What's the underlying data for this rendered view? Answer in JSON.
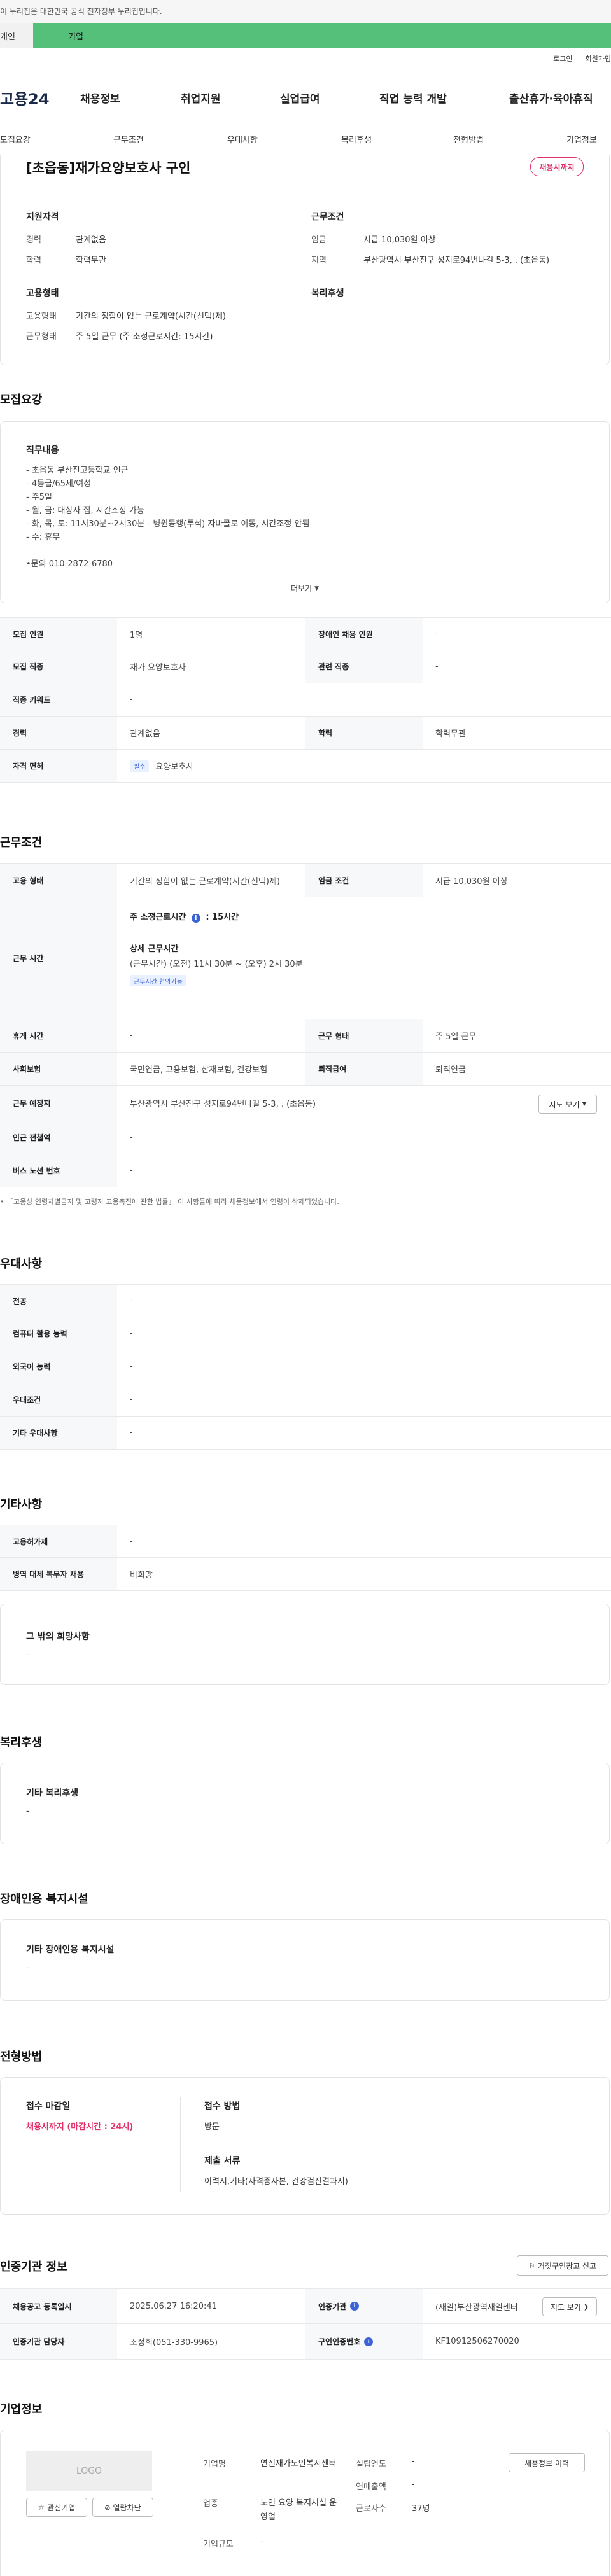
{
  "gov_notice": "이 누리집은 대한민국 공식 전자정부 누리집입니다.",
  "top_tabs": [
    "개인",
    "기업"
  ],
  "util_links": [
    "로그인",
    "회원가입"
  ],
  "logo": "고용24",
  "gnb": [
    "채용정보",
    "취업지원",
    "실업급여",
    "직업 능력 개발",
    "출산휴가·육아휴직"
  ],
  "subnav": [
    "모집요강",
    "근무조건",
    "우대사항",
    "복리후생",
    "전형방법",
    "기업정보"
  ],
  "job": {
    "title": "[초읍동]재가요양보호사 구인",
    "status_badge": "채용시까지",
    "summary": {
      "qual_title": "지원자격",
      "career_label": "경력",
      "career_value": "관계없음",
      "edu_label": "학력",
      "edu_value": "학력무관",
      "emp_title": "고용형태",
      "emp_type_label": "고용형태",
      "emp_type_value": "기간의 정함이 없는 근로계약(시간(선택)제)",
      "work_form_label": "근무형태",
      "work_form_value": "주 5일 근무 (주 소정근로시간: 15시간)",
      "cond_title": "근무조건",
      "wage_label": "임금",
      "wage_value": "시급 10,030원 이상",
      "region_label": "지역",
      "region_value": "부산광역시 부산진구 성지로94번나길 5-3, . (초읍동)",
      "welfare_title": "복리후생"
    }
  },
  "recruit": {
    "title": "모집요강",
    "duty_title": "직무내용",
    "duty_lines": [
      "- 초읍동 부산진고등학교 인근",
      "- 4등급/65세/여성",
      "- 주5일",
      "- 월, 금: 대상자 집, 시간조정 가능",
      "- 화, 목, 토: 11시30분~2시30분 - 병원동행(투석) 자바콜로 이동, 시간조정 안됨",
      "- 수: 휴무",
      "",
      "•문의 010-2872-6780"
    ],
    "more_label": "더보기",
    "rows": [
      {
        "k": "모집 인원",
        "v": "1명",
        "k2": "장애인 채용 인원",
        "v2": "-"
      },
      {
        "k": "모집 직종",
        "v": "재가 요양보호사",
        "k2": "관련 직종",
        "v2": "-"
      },
      {
        "k": "직종 키워드",
        "v": "-"
      },
      {
        "k": "경력",
        "v": "관계없음",
        "k2": "학력",
        "v2": "학력무관"
      }
    ],
    "license_label": "자격 면허",
    "license_chip": "필수",
    "license_value": "요양보호사"
  },
  "work": {
    "title": "근무조건",
    "emp_type_label": "고용 형태",
    "emp_type_value": "기간의 정함이 없는 근로계약(시간(선택)제)",
    "wage_label": "임금 조건",
    "wage_value": "시급 10,030원 이상",
    "hours_label": "근무 시간",
    "weekly_hours_label": "주 소정근로시간",
    "weekly_hours_value": "15시간",
    "detail_hours_label": "상세 근무시간",
    "detail_hours_value": "(근무시간) (오전) 11시 30분 ~ (오후) 2시 30분",
    "hours_chip": "근무시간 협의가능",
    "rows": [
      {
        "k": "휴게 시간",
        "v": "-",
        "k2": "근무 형태",
        "v2": "주 5일 근무"
      },
      {
        "k": "사회보험",
        "v": "국민연금, 고용보험, 산재보험, 건강보험",
        "k2": "퇴직급여",
        "v2": "퇴직연금"
      }
    ],
    "location_label": "근무 예정지",
    "location_value": "부산광역시 부산진구 성지로94번나길 5-3, . (초읍동)",
    "map_button": "지도 보기",
    "subway_label": "인근 전철역",
    "subway_value": "-",
    "bus_label": "버스 노선 번호",
    "bus_value": "-",
    "notice": "「고용상 연령차별금지 및 고령자 고용촉진에 관한 법률」 이 사항들에 따라 채용정보에서 연령이 삭제되었습니다."
  },
  "preferred": {
    "title": "우대사항",
    "rows": [
      {
        "k": "전공",
        "v": "-"
      },
      {
        "k": "컴퓨터 활용 능력",
        "v": "-"
      },
      {
        "k": "외국어 능력",
        "v": "-"
      },
      {
        "k": "우대조건",
        "v": "-"
      },
      {
        "k": "기타 우대사항",
        "v": "-"
      }
    ]
  },
  "etc": {
    "title": "기타사항",
    "rows": [
      {
        "k": "고용허가제",
        "v": "-"
      },
      {
        "k": "병역 대체 복무자 채용",
        "v": "비희망"
      }
    ],
    "other_title": "그 밖의 희망사항",
    "other_value": "-"
  },
  "welfare": {
    "title": "복리후생",
    "box_title": "기타 복리후생",
    "box_value": "-"
  },
  "disability": {
    "title": "장애인용 복지시설",
    "box_title": "기타 장애인용 복지시설",
    "box_value": "-"
  },
  "selection": {
    "title": "전형방법",
    "deadline_label": "접수 마감일",
    "deadline_value": "채용시까지 (마감시간 : 24시)",
    "method_label": "접수 방법",
    "method_value": "방문",
    "docs_label": "제출 서류",
    "docs_value": "이력서,기타(자격증사본, 건강검진결과지)"
  },
  "cert": {
    "title": "인증기관 정보",
    "report_button": "거짓구인광고 신고",
    "rows": [
      {
        "k": "채용공고 등록일시",
        "v": "2025.06.27 16:20:41",
        "k2": "인증기관",
        "v2": "(새일)부산광역새일센터"
      },
      {
        "k": "인증기관 담당자",
        "v": "조정희(051-330-9965)",
        "k2": "구인인증번호",
        "v2": "KF10912506270020"
      }
    ],
    "map_button": "지도 보기"
  },
  "company": {
    "title": "기업정보",
    "logo_placeholder": "LOGO",
    "interest_button": "관심기업",
    "block_button": "열람차단",
    "name_label": "기업명",
    "name_value": "연진재가노인복지센터",
    "industry_label": "업종",
    "industry_value": "노인 요양 복지시설 운영업",
    "size_label": "기업규모",
    "size_value": "-",
    "founded_label": "설립연도",
    "founded_value": "-",
    "revenue_label": "연매출액",
    "revenue_value": "-",
    "employees_label": "근로자수",
    "employees_value": "37명",
    "history_button": "채용정보 이력"
  },
  "colors": {
    "accent_green": "#54c07a",
    "accent_red": "#e0336a",
    "accent_blue": "#3b63d6"
  }
}
